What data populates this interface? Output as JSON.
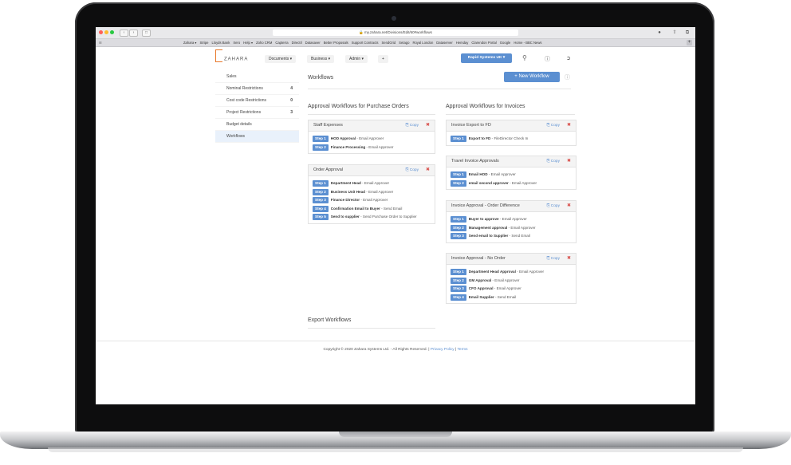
{
  "browser": {
    "url": "my.zahara.net/Divisions/Edit/60#workflows",
    "bookmarks": [
      "Zahara ▾",
      "Stripe",
      "Lloyds Bank",
      "Xero",
      "Help ▾",
      "Zoho CRM",
      "Capterra",
      "DirectIl",
      "Datasaver",
      "Better Proposals",
      "Support Contracts",
      "SendGrid",
      "Setago",
      "Royal London",
      "Dataserver",
      "Hemday",
      "Clarendon Portal",
      "Google",
      "Home - BBC News"
    ]
  },
  "header": {
    "logo": "ZAHARA",
    "menus": [
      "Documents ▾",
      "Business ▾",
      "Admin ▾",
      "+"
    ],
    "company": "Rapid Systems UK ▾"
  },
  "sidebar": {
    "items": [
      {
        "label": "Sales",
        "count": ""
      },
      {
        "label": "Nominal Restrictions",
        "count": "4"
      },
      {
        "label": "Cost code Restrictions",
        "count": "0"
      },
      {
        "label": "Project Restrictions",
        "count": "3"
      },
      {
        "label": "Budget details",
        "count": ""
      },
      {
        "label": "Workflows",
        "count": ""
      }
    ]
  },
  "main": {
    "title": "Workflows",
    "new_button": "+ New Workflow",
    "po_heading": "Approval Workflows for Purchase Orders",
    "inv_heading": "Approval Workflows for Invoices",
    "export_heading": "Export Workflows",
    "copy_label": "Copy",
    "po_workflows": [
      {
        "name": "Staff Expenses",
        "steps": [
          {
            "badge": "Step 1",
            "name": "HOD Approval",
            "action": " - Email Approver"
          },
          {
            "badge": "Step 2",
            "name": "Finance Processing",
            "action": " - Email Approver"
          }
        ]
      },
      {
        "name": "Order Approval",
        "steps": [
          {
            "badge": "Step 1",
            "name": "Department Head",
            "action": " - Email Approver"
          },
          {
            "badge": "Step 2",
            "name": "Business Unit Head",
            "action": " - Email Approver"
          },
          {
            "badge": "Step 3",
            "name": "Finance Director",
            "action": " - Email Approver"
          },
          {
            "badge": "Step 4",
            "name": "Confirmation Email to Buyer",
            "action": " - Send Email"
          },
          {
            "badge": "Step 5",
            "name": "Send to supplier",
            "action": " - Send Purchase Order to Supplier"
          }
        ]
      }
    ],
    "inv_workflows": [
      {
        "name": "Invoice Export to FD",
        "steps": [
          {
            "badge": "Step 1",
            "name": "Export to FD",
            "action": " - FileDirector Check In"
          }
        ]
      },
      {
        "name": "Travel Invoice Approvals",
        "steps": [
          {
            "badge": "Step 1",
            "name": "Email HOD",
            "action": " - Email Approver"
          },
          {
            "badge": "Step 2",
            "name": "email second approver",
            "action": " - Email Approver"
          }
        ]
      },
      {
        "name": "Invoice Approval - Order Difference",
        "steps": [
          {
            "badge": "Step 1",
            "name": "Buyer to approve",
            "action": " - Email Approver"
          },
          {
            "badge": "Step 2",
            "name": "Management approval",
            "action": " - Email Approver"
          },
          {
            "badge": "Step 3",
            "name": "Send email to Supplier",
            "action": " - Send Email"
          }
        ]
      },
      {
        "name": "Invoice Approval - No Order",
        "steps": [
          {
            "badge": "Step 1",
            "name": "Department Head Approval",
            "action": " - Email Approver"
          },
          {
            "badge": "Step 2",
            "name": "GM Approval",
            "action": " - Email Approver"
          },
          {
            "badge": "Step 3",
            "name": "CFO Approval",
            "action": " - Email Approver"
          },
          {
            "badge": "Step 4",
            "name": "Email Supplier",
            "action": " - Send Email"
          }
        ]
      }
    ]
  },
  "footer": {
    "copyright": "Copyright © 2020 Zahara Systems Ltd. - All Rights Reserved.",
    "sep": " | ",
    "privacy": "Privacy Policy",
    "terms": "Terms"
  }
}
